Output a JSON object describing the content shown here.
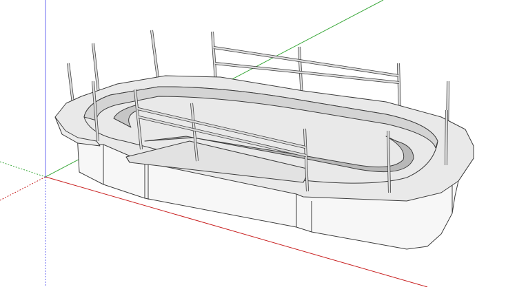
{
  "viewport": {
    "background": "#ffffff",
    "axis_colors": {
      "red": "#c81e1e",
      "green": "#3aa83a",
      "blue": "#6a6af0"
    }
  },
  "model": {
    "description_visible": false,
    "fill_colors": {
      "top_surface": "#e9e9e9",
      "outer_wall": "#f7f7f7",
      "inner_wall": "#d4d4d4",
      "inner_floor": "#b8b8b8",
      "rail": "#dcdcdc",
      "edge": "#3c3c3c"
    }
  }
}
